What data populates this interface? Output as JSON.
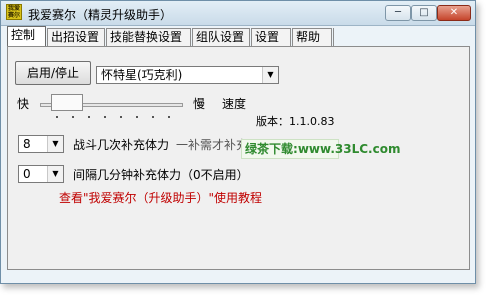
{
  "window": {
    "title": "我爱赛尔（精灵升级助手）",
    "icon_text": "我爱赛尔"
  },
  "titlebar_buttons": {
    "minimize": "─",
    "maximize": "□",
    "close": "✕"
  },
  "tabs": [
    {
      "label": "控制",
      "active": true
    },
    {
      "label": "出招设置",
      "active": false
    },
    {
      "label": "技能替换设置",
      "active": false
    },
    {
      "label": "组队设置",
      "active": false
    },
    {
      "label": "设置",
      "active": false
    },
    {
      "label": "帮助",
      "active": false
    }
  ],
  "control": {
    "start_stop_label": "启用/停止",
    "pet_select": {
      "value": "怀特星(巧克利)"
    },
    "speed": {
      "fast_label": "快",
      "slow_label": "慢",
      "speed_label": "速度",
      "value": 0.1
    },
    "version": "版本：1.1.0.83",
    "battle_refill": {
      "value": "8",
      "text": "战斗几次补充体力"
    },
    "battle_refill_overlap": "一补需才补充",
    "interval_refill": {
      "value": "0",
      "text": "间隔几分钟补充体力（0不启用）"
    },
    "tutorial_link": "查看\"我爱赛尔（升级助手）\"使用教程"
  },
  "watermark": {
    "prefix": "绿茶下载",
    "url": "www.33LC.com"
  },
  "colors": {
    "link": "#c00000",
    "watermark": "#2f8a2f"
  }
}
